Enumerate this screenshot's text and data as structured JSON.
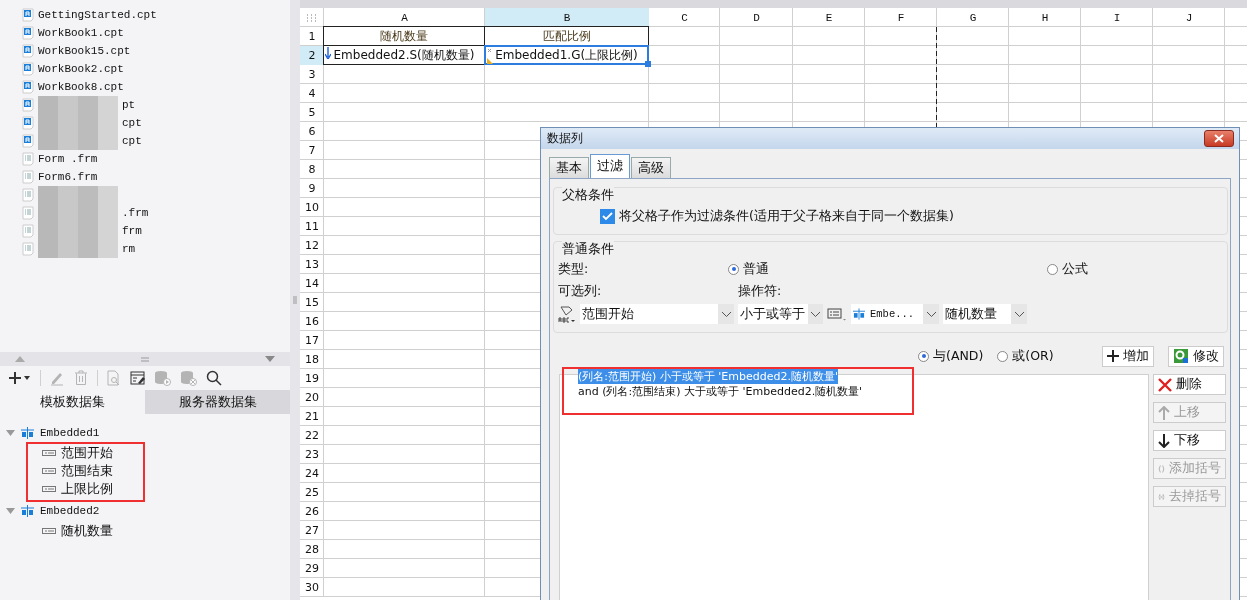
{
  "files": [
    {
      "name": "GettingStarted.cpt",
      "kind": "report",
      "masked": false
    },
    {
      "name": "WorkBook1.cpt",
      "kind": "report",
      "masked": false
    },
    {
      "name": "WorkBook15.cpt",
      "kind": "report",
      "masked": false
    },
    {
      "name": "WorkBook2.cpt",
      "kind": "report",
      "masked": false
    },
    {
      "name": "WorkBook8.cpt",
      "kind": "report",
      "masked": false
    },
    {
      "name": "pt",
      "kind": "report",
      "masked": true
    },
    {
      "name": "cpt",
      "kind": "report",
      "masked": true
    },
    {
      "name": "cpt",
      "kind": "report",
      "masked": true
    },
    {
      "name": "Form .frm",
      "kind": "form",
      "masked": false
    },
    {
      "name": "Form6.frm",
      "kind": "form",
      "masked": false
    },
    {
      "kind": "form",
      "masked": true
    },
    {
      "name": ".frm",
      "kind": "form",
      "masked": true
    },
    {
      "name": "frm",
      "kind": "form",
      "masked": true
    },
    {
      "name": "rm",
      "kind": "form",
      "masked": true
    }
  ],
  "toolbar": [
    {
      "kind": "add",
      "disabled": false
    },
    {
      "kind": "edit",
      "disabled": true
    },
    {
      "kind": "delete",
      "disabled": true
    },
    {
      "kind": "preview",
      "disabled": true
    },
    {
      "kind": "edit-dataset",
      "disabled": false
    },
    {
      "kind": "db-run",
      "disabled": true
    },
    {
      "kind": "db-remove",
      "disabled": true
    },
    {
      "kind": "search",
      "disabled": false
    }
  ],
  "dataset_tabs": [
    {
      "label": "模板数据集",
      "selected": true
    },
    {
      "label": "服务器数据集",
      "selected": false
    }
  ],
  "datasets": [
    {
      "name": "Embedded1",
      "expanded": true,
      "highlighted": true,
      "children": [
        {
          "name": "范围开始"
        },
        {
          "name": "范围结束"
        },
        {
          "name": "上限比例"
        }
      ]
    },
    {
      "name": "Embedded2",
      "expanded": true,
      "highlighted": false,
      "children": [
        {
          "name": "随机数量"
        }
      ]
    }
  ],
  "sheet": {
    "columns": [
      {
        "label": "A",
        "selected": false
      },
      {
        "label": "B",
        "selected": true
      },
      {
        "label": "C",
        "selected": false
      },
      {
        "label": "D",
        "selected": false
      },
      {
        "label": "E",
        "selected": false
      },
      {
        "label": "F",
        "selected": false
      },
      {
        "label": "G",
        "selected": false
      },
      {
        "label": "H",
        "selected": false
      },
      {
        "label": "I",
        "selected": false
      },
      {
        "label": "J",
        "selected": false
      }
    ],
    "rows": [
      {
        "label": "1",
        "selected": false,
        "cells": [
          {
            "text": "随机数量",
            "kind": "header",
            "selected": false
          },
          {
            "text": "匹配比例",
            "kind": "header",
            "selected": false
          }
        ]
      },
      {
        "label": "2",
        "selected": true,
        "cells": [
          {
            "text": "Embedded2.S(随机数量)",
            "kind": "list",
            "selected": false
          },
          {
            "text": "Embedded1.G(上限比例)",
            "kind": "group",
            "selected": true
          }
        ]
      },
      {
        "label": "3",
        "selected": false
      },
      {
        "label": "4",
        "selected": false
      },
      {
        "label": "5",
        "selected": false
      },
      {
        "label": "6",
        "selected": false
      },
      {
        "label": "7",
        "selected": false
      },
      {
        "label": "8",
        "selected": false
      },
      {
        "label": "9",
        "selected": false
      },
      {
        "label": "10",
        "selected": false
      },
      {
        "label": "11",
        "selected": false
      },
      {
        "label": "12",
        "selected": false
      },
      {
        "label": "13",
        "selected": false
      },
      {
        "label": "14",
        "selected": false
      },
      {
        "label": "15",
        "selected": false
      },
      {
        "label": "16",
        "selected": false
      },
      {
        "label": "17",
        "selected": false
      },
      {
        "label": "18",
        "selected": false
      },
      {
        "label": "19",
        "selected": false
      },
      {
        "label": "20",
        "selected": false
      },
      {
        "label": "21",
        "selected": false
      },
      {
        "label": "22",
        "selected": false
      },
      {
        "label": "23",
        "selected": false
      },
      {
        "label": "24",
        "selected": false
      },
      {
        "label": "25",
        "selected": false
      },
      {
        "label": "26",
        "selected": false
      },
      {
        "label": "27",
        "selected": false
      },
      {
        "label": "28",
        "selected": false
      },
      {
        "label": "29",
        "selected": false
      },
      {
        "label": "30",
        "selected": false
      }
    ]
  },
  "dialog": {
    "title": "数据列",
    "tabs": [
      {
        "label": "基本",
        "selected": false
      },
      {
        "label": "过滤",
        "selected": true
      },
      {
        "label": "高级",
        "selected": false
      }
    ],
    "parent_group": {
      "title": "父格条件",
      "checkbox": {
        "label": "将父格子作为过滤条件(适用于父子格来自于同一个数据集)",
        "checked": true
      }
    },
    "normal_group": {
      "title": "普通条件",
      "type_label": "类型:",
      "types": [
        {
          "label": "普通",
          "selected": true
        },
        {
          "label": "公式",
          "selected": false
        }
      ],
      "column_label": "可选列:",
      "operator_label": "操作符:",
      "column": "范围开始",
      "operator": "小于或等于",
      "dataset": "Embe...",
      "field": "随机数量"
    },
    "logic": [
      {
        "label": "与(AND)",
        "selected": true
      },
      {
        "label": "或(OR)",
        "selected": false
      }
    ],
    "top_buttons": [
      {
        "label": "增加",
        "kind": "add"
      },
      {
        "label": "修改",
        "kind": "modify"
      }
    ],
    "conditions_highlighted": true,
    "conditions": [
      {
        "text": "(列名:范围开始) 小于或等于 'Embedded2.随机数量'",
        "selected": true
      },
      {
        "text": "and (列名:范围结束) 大于或等于 'Embedded2.随机数量'",
        "selected": false
      }
    ],
    "side_buttons": [
      {
        "label": "删除",
        "kind": "delete",
        "disabled": false
      },
      {
        "label": "上移",
        "kind": "up",
        "disabled": true
      },
      {
        "label": "下移",
        "kind": "down",
        "disabled": false
      },
      {
        "label": "添加括号",
        "kind": "add-paren",
        "disabled": true
      },
      {
        "label": "去掉括号",
        "kind": "remove-paren",
        "disabled": true
      }
    ]
  }
}
